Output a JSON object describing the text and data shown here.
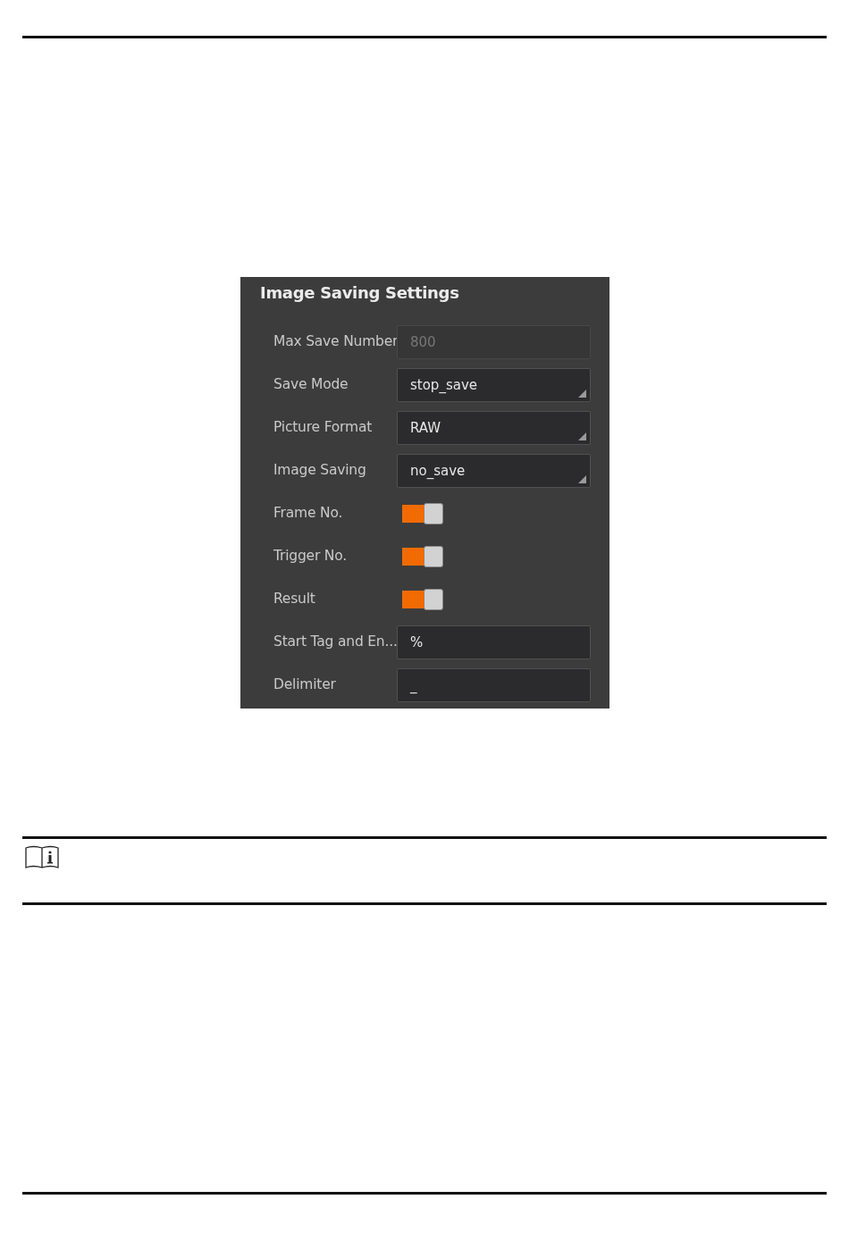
{
  "panel": {
    "title": "Image Saving Settings",
    "rows": [
      {
        "kind": "text",
        "label": "Max Save Number",
        "value": "800",
        "disabled": true
      },
      {
        "kind": "select",
        "label": "Save Mode",
        "value": "stop_save",
        "disabled": false
      },
      {
        "kind": "select",
        "label": "Picture Format",
        "value": "RAW",
        "disabled": false
      },
      {
        "kind": "select",
        "label": "Image Saving",
        "value": "no_save",
        "disabled": false
      },
      {
        "kind": "toggle",
        "label": "Frame No.",
        "on": true
      },
      {
        "kind": "toggle",
        "label": "Trigger No.",
        "on": true
      },
      {
        "kind": "toggle",
        "label": "Result",
        "on": true
      },
      {
        "kind": "text",
        "label": "Start Tag and En...",
        "value": "%",
        "disabled": false
      },
      {
        "kind": "text",
        "label": "Delimiter",
        "value": "_",
        "disabled": false
      }
    ]
  }
}
